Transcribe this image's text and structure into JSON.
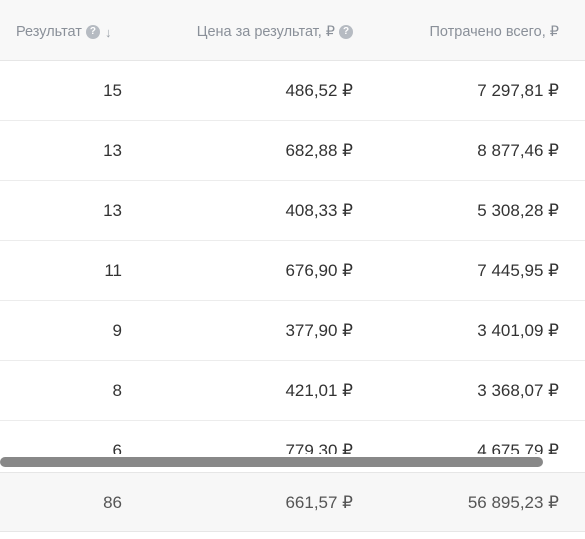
{
  "header": {
    "result_label": "Результат",
    "price_label": "Цена за результат, ₽",
    "spent_label": "Потрачено всего, ₽",
    "help_glyph": "?",
    "sort_glyph": "↓"
  },
  "rows": [
    {
      "result": "15",
      "price": "486,52 ₽",
      "spent": "7 297,81 ₽"
    },
    {
      "result": "13",
      "price": "682,88 ₽",
      "spent": "8 877,46 ₽"
    },
    {
      "result": "13",
      "price": "408,33 ₽",
      "spent": "5 308,28 ₽"
    },
    {
      "result": "11",
      "price": "676,90 ₽",
      "spent": "7 445,95 ₽"
    },
    {
      "result": "9",
      "price": "377,90 ₽",
      "spent": "3 401,09 ₽"
    },
    {
      "result": "8",
      "price": "421,01 ₽",
      "spent": "3 368,07 ₽"
    },
    {
      "result": "6",
      "price": "779,30 ₽",
      "spent": "4 675,79 ₽"
    }
  ],
  "totals": {
    "result": "86",
    "price": "661,57 ₽",
    "spent": "56 895,23 ₽"
  }
}
